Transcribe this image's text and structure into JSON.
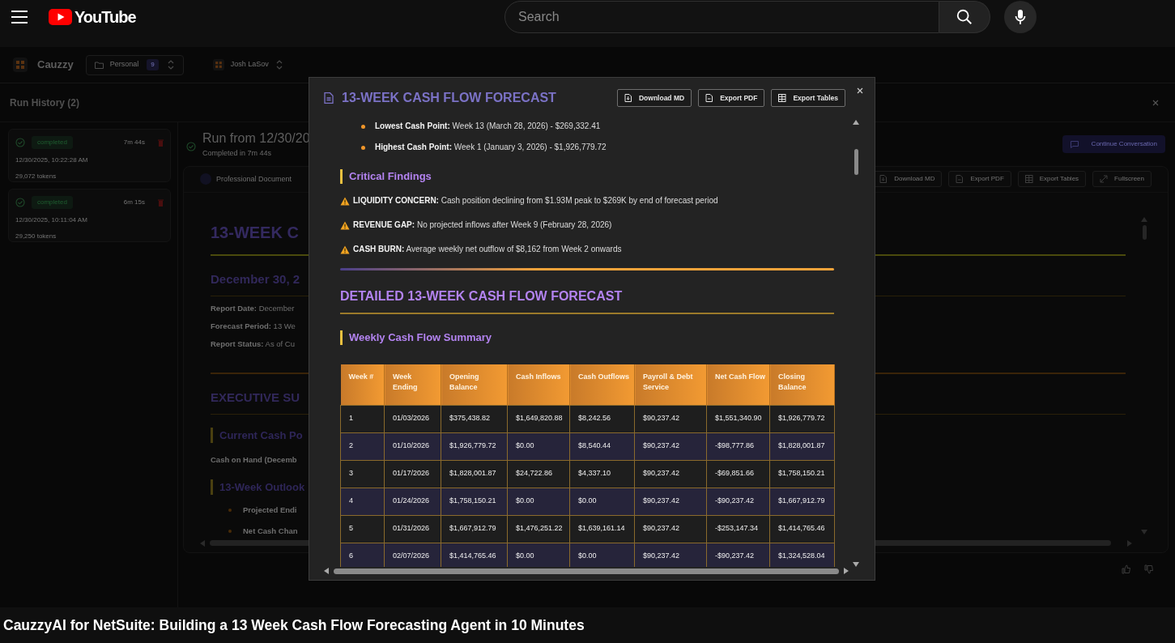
{
  "youtube": {
    "logo_text": "YouTube",
    "search": {
      "placeholder": "Search"
    },
    "video_title": "CauzzyAI for NetSuite: Building a 13 Week Cash Flow Forecasting Agent in 10 Minutes"
  },
  "app": {
    "brand": "Cauzzy",
    "workspace": {
      "label": "Personal",
      "count": "9"
    },
    "user": {
      "name": "Josh LaSov"
    },
    "run_history": {
      "title": "Run History (2)",
      "runs": [
        {
          "status": "completed",
          "duration": "7m 44s",
          "date": "12/30/2025, 10:22:28 AM",
          "tokens": "29,072 tokens"
        },
        {
          "status": "completed",
          "duration": "6m 15s",
          "date": "12/30/2025, 10:11:04 AM",
          "tokens": "29,250 tokens"
        }
      ]
    },
    "run_detail": {
      "title": "Run from 12/30/20",
      "subtitle": "Completed in 7m 44s",
      "action": "Continue Conversation",
      "document": {
        "subtitle": "Professional Document",
        "toolbar": [
          "Download MD",
          "Export PDF",
          "Export Tables",
          "Fullscreen"
        ],
        "blocks": [
          {
            "kind": "h1",
            "text": "13-WEEK C"
          },
          {
            "kind": "h2",
            "text": "December 30, 2"
          },
          {
            "kind": "meta",
            "text": "**Report Date:** December"
          },
          {
            "kind": "meta",
            "text": "**Forecast Period:** 13 We"
          },
          {
            "kind": "meta",
            "text": "**Report Status:** As of Cu"
          },
          {
            "kind": "hr"
          },
          {
            "kind": "h2",
            "text": "EXECUTIVE SU"
          },
          {
            "kind": "h3",
            "text": "Current Cash Po"
          },
          {
            "kind": "strong",
            "text": "Cash on Hand (Decemb"
          },
          {
            "kind": "h3",
            "text": "13-Week Outlook"
          },
          {
            "kind": "strong_bullet",
            "text": "Projected Endi"
          },
          {
            "kind": "strong_bullet",
            "text": "Net Cash Chan"
          }
        ]
      }
    }
  },
  "modal": {
    "title": "13-WEEK CASH FLOW FORECAST",
    "buttons": [
      "Download MD",
      "Export PDF",
      "Export Tables"
    ],
    "blocks": [
      {
        "kind": "bullet",
        "text": "**Lowest Cash Point:** Week 13 (March 28, 2026) - $269,332.41"
      },
      {
        "kind": "bullet",
        "text": "**Highest Cash Point:** Week 1 (January 3, 2026) - $1,926,779.72"
      },
      {
        "kind": "h3",
        "text": "Critical Findings"
      },
      {
        "kind": "finding",
        "text": "**LIQUIDITY CONCERN:** Cash position declining from $1.93M peak to $269K by end of forecast period"
      },
      {
        "kind": "finding",
        "text": "**REVENUE GAP:** No projected inflows after Week 9 (February 28, 2026)"
      },
      {
        "kind": "finding",
        "text": "**CASH BURN:** Average weekly net outflow of $8,162 from Week 2 onwards"
      },
      {
        "kind": "hr"
      },
      {
        "kind": "h2",
        "text": "DETAILED 13-WEEK CASH FLOW FORECAST"
      },
      {
        "kind": "h3",
        "text": "Weekly Cash Flow Summary"
      },
      {
        "kind": "table",
        "columns": [
          "Week #",
          "Week Ending",
          "Opening Balance",
          "Cash Inflows",
          "Cash Outflows",
          "Payroll & Debt Service",
          "Net Cash Flow",
          "Closing Balance"
        ],
        "rows": [
          [
            "1",
            "01/03/2026",
            "$375,438.82",
            "$1,649,820.88",
            "$8,242.56",
            "$90,237.42",
            "$1,551,340.90",
            "$1,926,779.72"
          ],
          [
            "2",
            "01/10/2026",
            "$1,926,779.72",
            "$0.00",
            "$8,540.44",
            "$90,237.42",
            "-$98,777.86",
            "$1,828,001.87"
          ],
          [
            "3",
            "01/17/2026",
            "$1,828,001.87",
            "$24,722.86",
            "$4,337.10",
            "$90,237.42",
            "-$69,851.66",
            "$1,758,150.21"
          ],
          [
            "4",
            "01/24/2026",
            "$1,758,150.21",
            "$0.00",
            "$0.00",
            "$90,237.42",
            "-$90,237.42",
            "$1,667,912.79"
          ],
          [
            "5",
            "01/31/2026",
            "$1,667,912.79",
            "$1,476,251.22",
            "$1,639,161.14",
            "$90,237.42",
            "-$253,147.34",
            "$1,414,765.46"
          ],
          [
            "6",
            "02/07/2026",
            "$1,414,765.46",
            "$0.00",
            "$0.00",
            "$90,237.42",
            "-$90,237.42",
            "$1,324,528.04"
          ]
        ]
      }
    ]
  }
}
